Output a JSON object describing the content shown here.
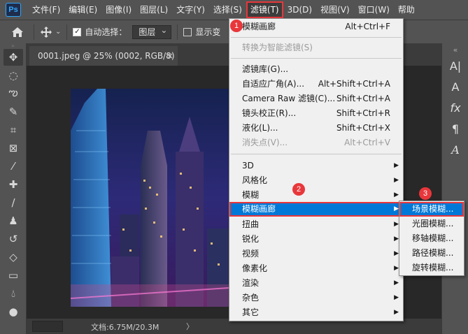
{
  "menubar": {
    "logo": "Ps",
    "items": [
      {
        "label": "文件(F)"
      },
      {
        "label": "编辑(E)"
      },
      {
        "label": "图像(I)"
      },
      {
        "label": "图层(L)"
      },
      {
        "label": "文字(Y)"
      },
      {
        "label": "选择(S)"
      },
      {
        "label": "滤镜(T)"
      },
      {
        "label": "3D(D)"
      },
      {
        "label": "视图(V)"
      },
      {
        "label": "窗口(W)"
      },
      {
        "label": "帮助"
      }
    ]
  },
  "options": {
    "auto_select_label": "自动选择：",
    "layer_select_value": "图层",
    "show_transform_label": "显示变"
  },
  "document": {
    "tab_title": "0001.jpeg @ 25% (0002, RGB/8) *",
    "close": "×"
  },
  "status": {
    "doc_info": "文档:6.75M/20.3M",
    "arrow": "〉"
  },
  "filter_menu": {
    "items": [
      {
        "label": "模糊画廊",
        "shortcut": "Alt+Ctrl+F"
      },
      {
        "label": "转换为智能滤镜(S)",
        "shortcut": ""
      },
      {
        "label": "滤镜库(G)...",
        "shortcut": ""
      },
      {
        "label": "自适应广角(A)...",
        "shortcut": "Alt+Shift+Ctrl+A"
      },
      {
        "label": "Camera Raw 滤镜(C)...",
        "shortcut": "Shift+Ctrl+A"
      },
      {
        "label": "镜头校正(R)...",
        "shortcut": "Shift+Ctrl+R"
      },
      {
        "label": "液化(L)...",
        "shortcut": "Shift+Ctrl+X"
      },
      {
        "label": "消失点(V)...",
        "shortcut": "Alt+Ctrl+V"
      },
      {
        "label": "3D",
        "shortcut": ""
      },
      {
        "label": "风格化",
        "shortcut": ""
      },
      {
        "label": "模糊",
        "shortcut": ""
      },
      {
        "label": "模糊画廊",
        "shortcut": ""
      },
      {
        "label": "扭曲",
        "shortcut": ""
      },
      {
        "label": "锐化",
        "shortcut": ""
      },
      {
        "label": "视频",
        "shortcut": ""
      },
      {
        "label": "像素化",
        "shortcut": ""
      },
      {
        "label": "渲染",
        "shortcut": ""
      },
      {
        "label": "杂色",
        "shortcut": ""
      },
      {
        "label": "其它",
        "shortcut": ""
      }
    ]
  },
  "blur_gallery_submenu": {
    "items": [
      {
        "label": "场景模糊..."
      },
      {
        "label": "光圈模糊..."
      },
      {
        "label": "移轴模糊..."
      },
      {
        "label": "路径模糊..."
      },
      {
        "label": "旋转模糊..."
      }
    ]
  },
  "annotations": {
    "step1": "1",
    "step2": "2",
    "step3": "3",
    "color": "#e8373b"
  },
  "right_panel": {
    "items": [
      "A|",
      "A",
      "fx",
      "¶",
      "A"
    ]
  }
}
